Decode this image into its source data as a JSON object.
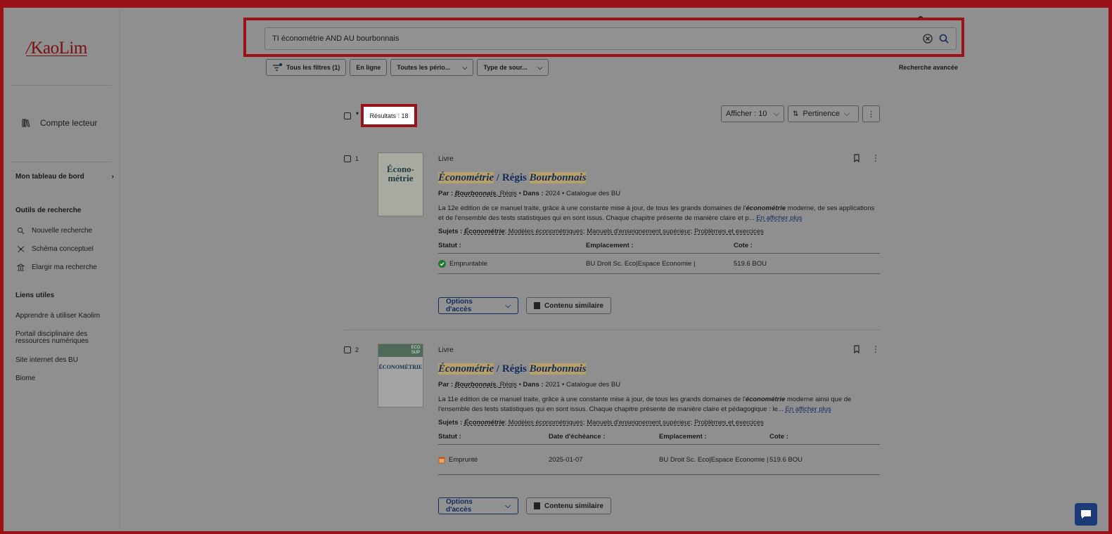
{
  "sidebar": {
    "logo": "KaoLim",
    "account": "Compte lecteur",
    "dashboard": "Mon tableau de bord",
    "tools_heading": "Outils de recherche",
    "tools": [
      "Nouvelle recherche",
      "Schéma conceptuel",
      "Elargir ma recherche"
    ],
    "links_heading": "Liens utiles",
    "links": [
      "Apprendre à utiliser Kaolim",
      "Portail disciplinaire des ressources numériques",
      "Site internet des BU",
      "Biome"
    ]
  },
  "search": {
    "query": "TI économétrie AND AU bourbonnais"
  },
  "filters": {
    "all": "Tous les filtres (1)",
    "online": "En ligne",
    "periods": "Toutes les pério...",
    "source": "Type de sour...",
    "advanced": "Recherche avancée"
  },
  "results_bar": {
    "count": "Résultats : 18",
    "display": "Afficher : 10",
    "sort": "Pertinence"
  },
  "results": [
    {
      "num": "1",
      "kind": "Livre",
      "title_a": "Économétrie",
      "title_sep": " / Régis ",
      "title_b": "Bourbonnais",
      "by_label": "Par :",
      "author_last": "Bourbonnais",
      "author_first": "Régis",
      "in_label": "Dans :",
      "year": "2024",
      "catalog": "Catalogue des BU",
      "desc_1": "La 12e édition de ce manuel traite, grâce à une constante mise à jour, de tous les grands domaines de l'",
      "desc_em": "économétrie",
      "desc_2": " moderne, de ses applications et de l'ensemble des tests statistiques qui en sont issus. Chaque chapitre présente de manière claire et p...",
      "more": "En afficher plus",
      "subjects_label": "Sujets :",
      "subjects": [
        "Économétrie",
        "Modèles économétriques",
        "Manuels d'enseignement supérieur",
        "Problèmes et exercices"
      ],
      "headers": [
        "Statut :",
        "Emplacement :",
        "Cote :"
      ],
      "row": [
        "Empruntable",
        "BU Droit Sc. Eco|Espace Economie |",
        "519.6 BOU"
      ],
      "cover_text": "Écono-métrie",
      "access": "Options d'accès",
      "similar": "Contenu similaire"
    },
    {
      "num": "2",
      "kind": "Livre",
      "title_a": "Économétrie",
      "title_sep": " / Régis ",
      "title_b": "Bourbonnais",
      "by_label": "Par :",
      "author_last": "Bourbonnais",
      "author_first": "Régis",
      "in_label": "Dans :",
      "year": "2021",
      "catalog": "Catalogue des BU",
      "desc_1": "La 11e édition de ce manuel traite, grâce à une constante mise à jour, de tous les grands domaines de l'",
      "desc_em": "économétrie",
      "desc_2": " moderne ainsi que de l'ensemble des tests statistiques qui en sont issus. Chaque chapitre présente de manière claire et pédagogique : le...",
      "more": "En afficher plus",
      "subjects_label": "Sujets :",
      "subjects": [
        "Économétrie",
        "Modèles économétriques",
        "Manuels d'enseignement supérieur",
        "Problèmes et exercices"
      ],
      "headers": [
        "Statut :",
        "Date d'échéance :",
        "Emplacement :",
        "Cote :"
      ],
      "row": [
        "Emprunté",
        "2025-01-07",
        "BU Droit Sc. Eco|Espace Economie |",
        "519.6 BOU"
      ],
      "cover_badge": "ECO SUP",
      "cover_text": "ÉCONOMÉTRIE",
      "access": "Options d'accès",
      "similar": "Contenu similaire"
    }
  ],
  "colors": {
    "frame": "#9a1118",
    "accent": "#112a5c",
    "highlight": "#b8a06a",
    "ok": "#1f7a2e",
    "borrowed": "#c25a12"
  }
}
